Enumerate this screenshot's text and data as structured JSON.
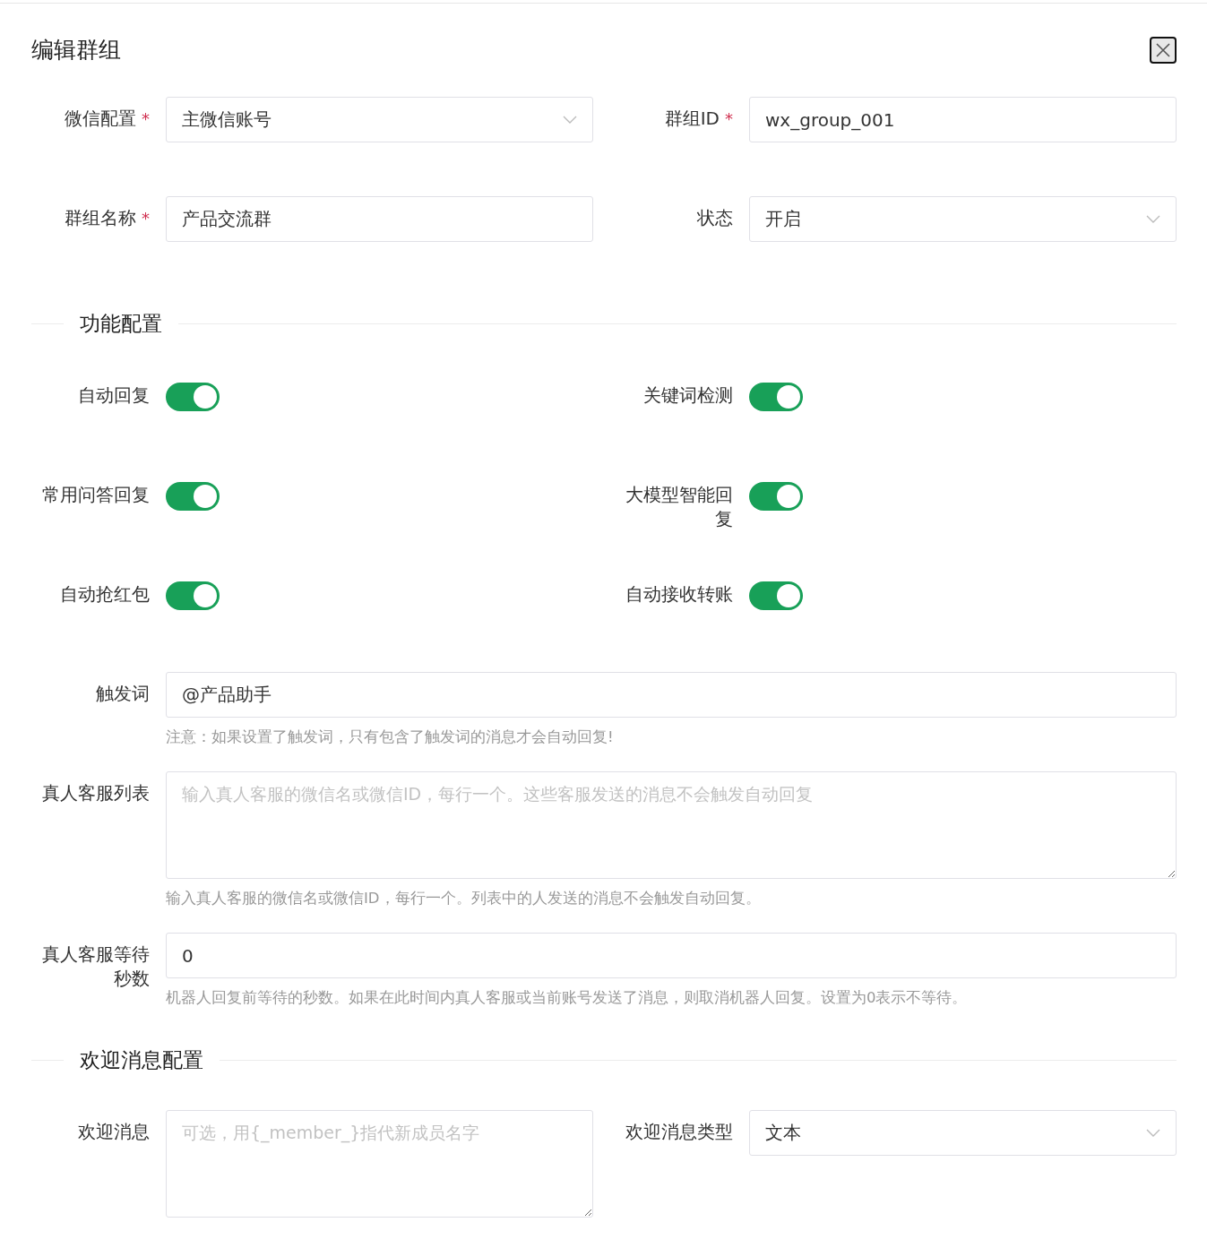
{
  "dialog": {
    "title": "编辑群组"
  },
  "basic_rows": [
    [
      {
        "kind": "select",
        "label": "微信配置",
        "required_mark": "*",
        "value": "主微信账号"
      },
      {
        "kind": "input",
        "label": "群组ID",
        "required_mark": "*",
        "value": "wx_group_001"
      }
    ],
    [
      {
        "kind": "input",
        "label": "群组名称",
        "required_mark": "*",
        "value": "产品交流群"
      },
      {
        "kind": "select",
        "label": "状态",
        "value": "开启"
      }
    ]
  ],
  "sections": [
    {
      "title": "功能配置",
      "rows": [
        [
          {
            "kind": "switch",
            "label": "自动回复",
            "on": true
          },
          {
            "kind": "switch",
            "label": "关键词检测",
            "on": true
          }
        ],
        [
          {
            "kind": "switch",
            "label": "常用问答回复",
            "on": true
          },
          {
            "kind": "switch",
            "label": "大模型智能回复",
            "on": true
          }
        ],
        [
          {
            "kind": "switch",
            "label": "自动抢红包",
            "on": true
          },
          {
            "kind": "switch",
            "label": "自动接收转账",
            "on": true
          }
        ],
        [
          {
            "kind": "input",
            "label": "触发词",
            "value": "@产品助手",
            "hint": "注意：如果设置了触发词，只有包含了触发词的消息才会自动回复!"
          }
        ],
        [
          {
            "kind": "textarea",
            "label": "真人客服列表",
            "placeholder": "输入真人客服的微信名或微信ID，每行一个。这些客服发送的消息不会触发自动回复",
            "hint": "输入真人客服的微信名或微信ID，每行一个。列表中的人发送的消息不会触发自动回复。"
          }
        ],
        [
          {
            "kind": "input",
            "label": "真人客服等待秒数",
            "value": "0",
            "hint": "机器人回复前等待的秒数。如果在此时间内真人客服或当前账号发送了消息，则取消机器人回复。设置为0表示不等待。"
          }
        ]
      ]
    },
    {
      "title": "欢迎消息配置",
      "rows": [
        [
          {
            "kind": "textarea",
            "label": "欢迎消息",
            "placeholder": "可选，用{_member_}指代新成员名字"
          },
          {
            "kind": "select",
            "label": "欢迎消息类型",
            "value": "文本"
          }
        ]
      ]
    }
  ]
}
